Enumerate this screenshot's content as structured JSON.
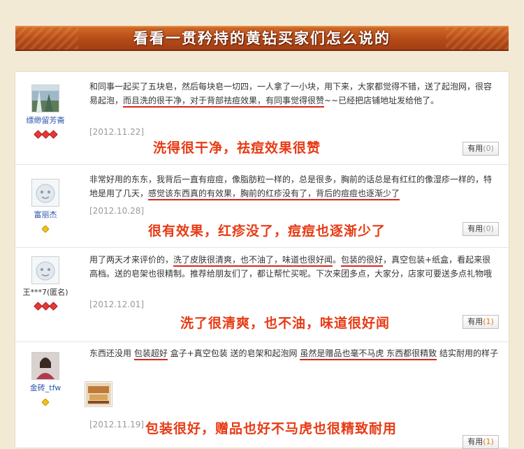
{
  "header": {
    "title": "看看一贯矜持的黄钻买家们怎么说的"
  },
  "reviews": [
    {
      "user": "缥缈留芳斋",
      "text_parts": [
        "和同事一起买了五块皂，然后每块皂一切四，一人拿了一小块，用下来，大家都觉得不错，送了起泡网，很容易起泡，",
        "而且洗的很干净，对于背部祛痘效果，有同事觉得很赞",
        "~~已经把店铺地址发给他了。"
      ],
      "date": "[2012.11.22]",
      "summary": "洗得很干净，祛痘效果很赞",
      "useful_label": "有用",
      "useful_count": "(0)",
      "badges": [
        "red",
        "red",
        "red"
      ]
    },
    {
      "user": "富丽杰",
      "text_parts": [
        "非常好用的东东，我背后一直有痘痘，像脂肪粒一样的，总是很多，胸前的话总是有红红的像湿疹一样的，特地是用了几天，",
        "感觉该东西真的有效果，胸前的红疹没有了，背后的痘痘也逐渐少了",
        ""
      ],
      "date": "[2012.10.28]",
      "summary": "很有效果，红疹没了，痘痘也逐渐少了",
      "useful_label": "有用",
      "useful_count": "(0)",
      "badges": [
        "yellow"
      ]
    },
    {
      "user": "王***7(匿名)",
      "text_parts": [
        "用了两天才来评价的，",
        "洗了皮肤很清爽，也不油了，味道也很好闻",
        "。",
        "包装的很好",
        "，真空包装+纸盒，看起来很高档。送的皂架也很精制。推荐给朋友们了，都让帮忙买呢。下次来团多点，大家分，店家可要送多点礼物哦"
      ],
      "date": "[2012.12.01]",
      "summary": "洗了很清爽，也不油，味道很好闻",
      "useful_label": "有用",
      "useful_count": "(1)",
      "badges": [
        "red",
        "red",
        "red"
      ]
    },
    {
      "user": "金砖_tfw",
      "text_parts": [
        "东西还没用 ",
        "包装超好",
        " 盒子+真空包装 送的皂架和起泡网 ",
        "虽然是赠品也毫不马虎 东西都很精致",
        " 结实耐用的样子"
      ],
      "date": "[2012.11.19]",
      "summary": "包装很好，赠品也好不马虎也很精致耐用",
      "useful_label": "有用",
      "useful_count": "(1)",
      "badges": [
        "yellow"
      ]
    }
  ]
}
